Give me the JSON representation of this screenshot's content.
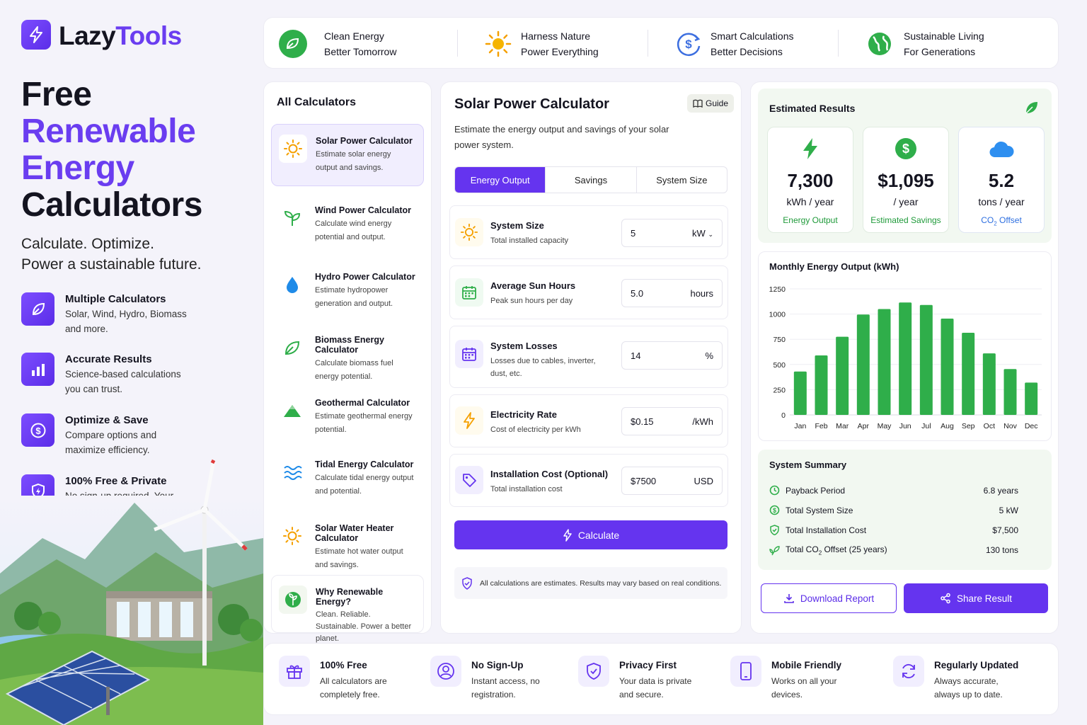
{
  "brand": {
    "name_a": "Lazy",
    "name_b": "Tools"
  },
  "hero": {
    "line1": "Free",
    "line2": "Renewable",
    "line3": "Energy",
    "line4": "Calculators"
  },
  "tagline": {
    "line1": "Calculate. Optimize.",
    "line2": "Power a sustainable future."
  },
  "features": [
    {
      "title": "Multiple Calculators",
      "desc": "Solar, Wind, Hydro, Biomass and more."
    },
    {
      "title": "Accurate Results",
      "desc": "Science-based calculations you can trust."
    },
    {
      "title": "Optimize & Save",
      "desc": "Compare options and maximize efficiency."
    },
    {
      "title": "100% Free & Private",
      "desc": "No sign-up required. Your data stays with you."
    }
  ],
  "banner": [
    {
      "l1": "Clean Energy",
      "l2": "Better Tomorrow",
      "icon": "leaf-icon"
    },
    {
      "l1": "Harness Nature",
      "l2": "Power Everything",
      "icon": "sun-icon"
    },
    {
      "l1": "Smart Calculations",
      "l2": "Better Decisions",
      "icon": "dollar-cycle-icon"
    },
    {
      "l1": "Sustainable Living",
      "l2": "For Generations",
      "icon": "globe-icon"
    }
  ],
  "sidebar": {
    "title": "All Calculators",
    "items": [
      {
        "title": "Solar Power Calculator",
        "desc": "Estimate solar energy output and savings.",
        "icon": "sun-icon"
      },
      {
        "title": "Wind Power Calculator",
        "desc": "Calculate wind energy potential and output.",
        "icon": "sprout-icon"
      },
      {
        "title": "Hydro Power Calculator",
        "desc": "Estimate hydropower generation and output.",
        "icon": "water-drop-icon"
      },
      {
        "title": "Biomass Energy Calculator",
        "desc": "Calculate biomass fuel energy potential.",
        "icon": "leaf-icon"
      },
      {
        "title": "Geothermal Calculator",
        "desc": "Estimate geothermal energy potential.",
        "icon": "mountain-icon"
      },
      {
        "title": "Tidal Energy Calculator",
        "desc": "Calculate tidal energy output and potential.",
        "icon": "waves-icon"
      },
      {
        "title": "Solar Water Heater Calculator",
        "desc": "Estimate hot water output and savings.",
        "icon": "sun-icon"
      },
      {
        "title": "Why Renewable Energy?",
        "desc": "Clean. Reliable. Sustainable. Power a better planet.",
        "icon": "earth-leaf-icon"
      }
    ]
  },
  "main": {
    "title": "Solar Power Calculator",
    "guide": "Guide",
    "desc": "Estimate the energy output and savings of your solar power system.",
    "tabs": [
      "Energy Output",
      "Savings",
      "System Size"
    ],
    "fields": [
      {
        "label": "System Size",
        "help": "Total installed capacity",
        "value": "5",
        "unit": "kW"
      },
      {
        "label": "Average Sun Hours",
        "help": "Peak sun hours per day",
        "value": "5.0",
        "unit": "hours"
      },
      {
        "label": "System Losses",
        "help": "Losses due to cables, inverter, dust, etc.",
        "value": "14",
        "unit": "%"
      },
      {
        "label": "Electricity Rate",
        "help": "Cost of electricity per kWh",
        "value": "$0.15",
        "unit": "/kWh"
      },
      {
        "label": "Installation Cost (Optional)",
        "help": "Total installation cost",
        "value": "$7500",
        "unit": "USD"
      }
    ],
    "calculate": "Calculate",
    "note": "All calculations are estimates. Results may vary based on real conditions."
  },
  "results": {
    "title": "Estimated Results",
    "boxes": [
      {
        "value": "7,300",
        "unit": "kWh / year",
        "label": "Energy Output"
      },
      {
        "value": "$1,095",
        "unit": "/ year",
        "label": "Estimated Savings"
      },
      {
        "value": "5.2",
        "unit": "tons / year",
        "label_a": "CO",
        "label_sub": "2",
        "label_b": " Offset"
      }
    ]
  },
  "chart_title": "Monthly Energy Output (kWh)",
  "chart_data": {
    "type": "bar",
    "title": "Monthly Energy Output (kWh)",
    "categories": [
      "Jan",
      "Feb",
      "Mar",
      "Apr",
      "May",
      "Jun",
      "Jul",
      "Aug",
      "Sep",
      "Oct",
      "Nov",
      "Dec"
    ],
    "values": [
      430,
      590,
      775,
      995,
      1050,
      1115,
      1090,
      955,
      815,
      610,
      455,
      320
    ],
    "yticks": [
      0,
      250,
      500,
      750,
      1000,
      1250
    ],
    "ylim": [
      0,
      1250
    ],
    "grid": true,
    "color": "#2fae4a"
  },
  "summary": {
    "title": "System Summary",
    "rows": [
      {
        "k": "Payback Period",
        "v": "6.8 years"
      },
      {
        "k": "Total System Size",
        "v": "5 kW"
      },
      {
        "k": "Total Installation Cost",
        "v": "$7,500"
      },
      {
        "k_a": "Total CO",
        "k_sub": "2",
        "k_b": " Offset (25 years)",
        "v": "130 tons"
      }
    ]
  },
  "actions": {
    "download": "Download Report",
    "share": "Share Result"
  },
  "footer": [
    {
      "title": "100% Free",
      "desc": "All calculators are completely free."
    },
    {
      "title": "No Sign-Up",
      "desc": "Instant access, no registration."
    },
    {
      "title": "Privacy First",
      "desc": "Your data is private and secure."
    },
    {
      "title": "Mobile Friendly",
      "desc": "Works on all your devices."
    },
    {
      "title": "Regularly Updated",
      "desc": "Always accurate, always up to date."
    }
  ],
  "colors": {
    "accent": "#6534ef",
    "green": "#2fae4a"
  }
}
